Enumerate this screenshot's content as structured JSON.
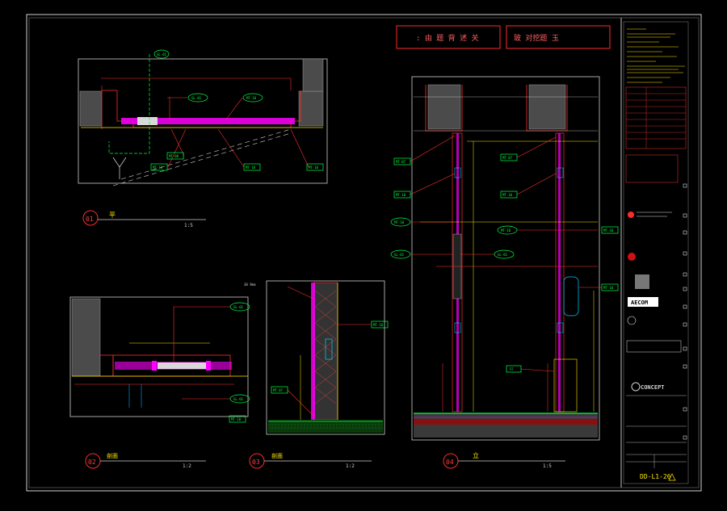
{
  "sheet": {
    "drawing_number": "DD-L1-26",
    "top_box_left": ": 由 题 背 述 关",
    "top_box_right": "玻  对挖题  玉"
  },
  "views": [
    {
      "number": "01",
      "title": "平",
      "scale": "1:5"
    },
    {
      "number": "02",
      "title": "剖面",
      "scale": "1:2"
    },
    {
      "number": "03",
      "title": "剖面",
      "scale": "1:2"
    },
    {
      "number": "04",
      "title": "立",
      "scale": "1:5"
    }
  ],
  "tags": {
    "v1_top": "GL-01",
    "v1_a": "GL-01",
    "v1_b": "MT-10",
    "v1_c": "MT-08",
    "v1_d": "MT-10",
    "v1_e": "MT-10",
    "v1_f": "MT-10",
    "v2_a": "GL-01",
    "v2_b": "GL-01",
    "v2_c": "MT-10",
    "v3_a": "MT-10",
    "v3_b": "MT-07",
    "v4_a": "MT-07",
    "v4_b": "MT-10",
    "v4_c": "MT-10",
    "v4_d": "GL-01",
    "v4_e": "MT-07",
    "v4_f": "MT-10",
    "v4_g": "MT-10",
    "v4_h": "MT-10",
    "v4_i": "GL-01",
    "v4_j": "MT-10",
    "v4_k": "FF"
  },
  "title_block": {
    "logo_aecom": "AECOM",
    "logo_concept": "CONCEPT",
    "small_rows": [
      "DD-L1-26"
    ]
  }
}
